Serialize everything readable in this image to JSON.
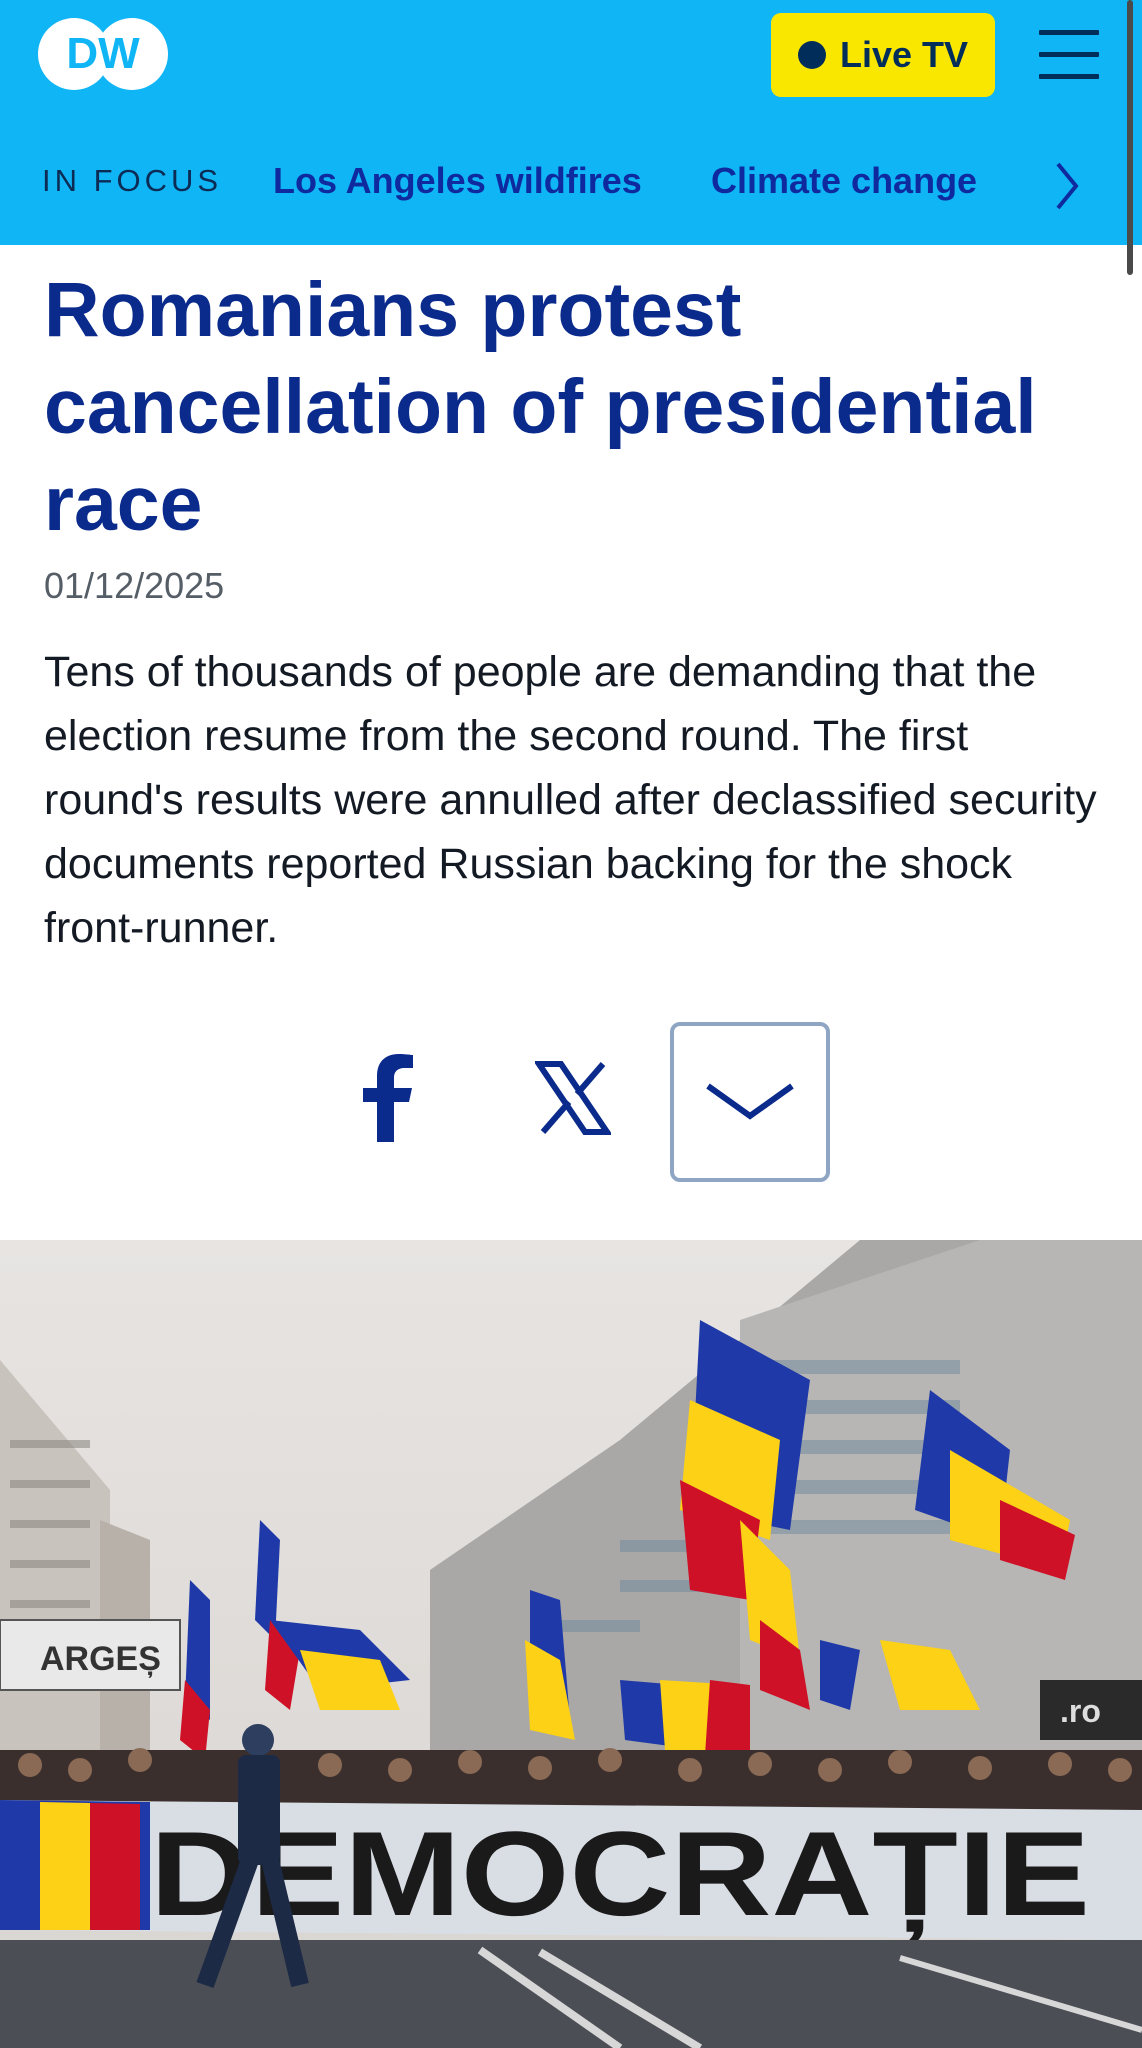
{
  "header": {
    "logo_text": "DW",
    "live_label": "Live TV",
    "menu_icon": "hamburger-menu-icon"
  },
  "focus_bar": {
    "label": "IN FOCUS",
    "links": [
      "Los Angeles wildfires",
      "Climate change"
    ],
    "next_icon": "chevron-right-icon"
  },
  "article": {
    "headline": "Romanians protest cancellation of presidential race",
    "date": "01/12/2025",
    "teaser": "Tens of thousands of people are demanding that the election resume from the second round. The first round's results were annulled after declassified security documents reported Russian backing for the shock front-runner."
  },
  "share": {
    "icons": [
      "facebook-icon",
      "x-icon",
      "chevron-down-icon"
    ]
  },
  "photo": {
    "banner_text": "DEMOCRAȚIE",
    "sign_text": "ARGEȘ",
    "billboard_text": ".ro"
  },
  "colors": {
    "header_bg": "#0fb5f5",
    "live_bg": "#fae700",
    "navy": "#002d5a",
    "headline": "#0a2a8c",
    "link": "#0f2a9e"
  }
}
